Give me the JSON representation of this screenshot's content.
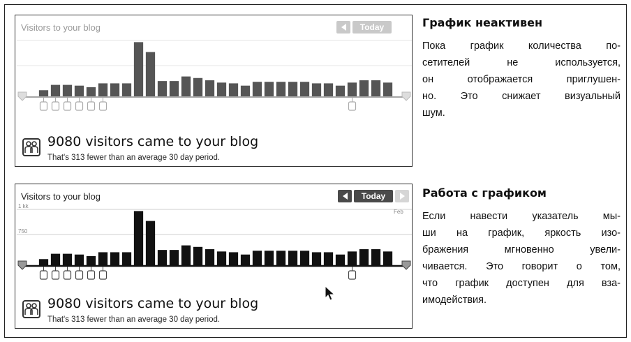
{
  "colors": {
    "inactive_bar": "#555555",
    "active_bar": "#111111",
    "inactive_text": "#9a9a9a"
  },
  "panels": [
    {
      "state": "inactive",
      "title": "Visitors to your blog",
      "nav": {
        "today_label": "Today",
        "prev_icon": "triangle-left-icon",
        "next_icon": "triangle-right-icon"
      },
      "y_tick_labels": [
        "",
        ""
      ],
      "x_end_label": "",
      "summary": {
        "icon": "people-icon",
        "title": "9080 visitors came to your blog",
        "subtitle": "That's 313 fewer than an average 30 day period."
      }
    },
    {
      "state": "active",
      "title": "Visitors to your blog",
      "nav": {
        "today_label": "Today",
        "prev_icon": "triangle-left-icon",
        "next_icon": "triangle-right-icon"
      },
      "y_tick_labels": [
        "1 kk",
        "750"
      ],
      "x_end_label": "Feb",
      "summary": {
        "icon": "people-icon",
        "title": "9080 visitors came to your blog",
        "subtitle": "That's 313 fewer than an average 30 day period."
      }
    }
  ],
  "chart_data": {
    "type": "bar",
    "values": [
      8,
      15,
      15,
      14,
      12,
      17,
      17,
      17,
      71,
      58,
      20,
      20,
      26,
      24,
      21,
      18,
      17,
      14,
      19,
      19,
      19,
      19,
      19,
      17,
      17,
      14,
      18,
      21,
      21,
      18
    ],
    "marker_positions": [
      1,
      2,
      3,
      4,
      5,
      6,
      27
    ]
  },
  "side": [
    {
      "heading": "График неактивен",
      "lines": [
        "Пока график количества по-",
        "сетителей не используется,",
        "он отображается приглушен-",
        "но. Это снижает визуальный",
        "шум."
      ]
    },
    {
      "heading": "Работа с графиком",
      "lines": [
        "Если навести указатель мы-",
        "ши на график, яркость изо-",
        "бражения мгновенно увели-",
        "чивается. Это говорит о том,",
        "что график доступен для вза-",
        "имодействия."
      ]
    }
  ]
}
